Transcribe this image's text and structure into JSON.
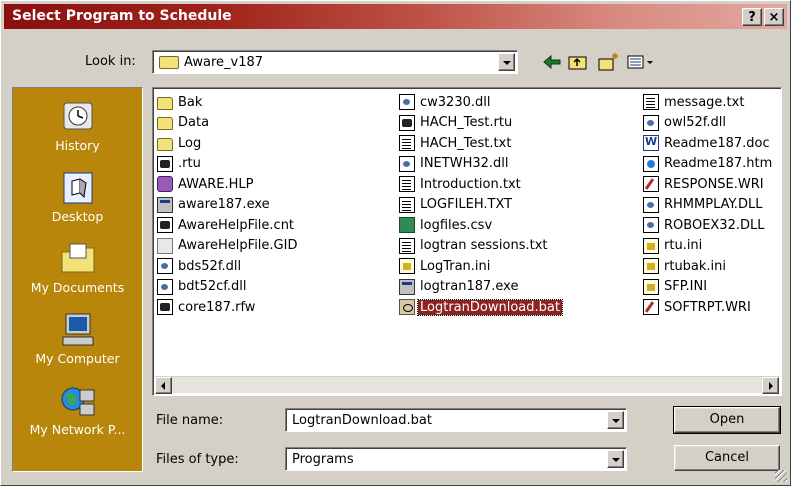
{
  "window": {
    "title": "Select Program to Schedule",
    "help_button": "?",
    "close_button": "×"
  },
  "look_in": {
    "label": "Look in:",
    "value": "Aware_v187"
  },
  "places": [
    {
      "label": "History",
      "icon": "history-icon"
    },
    {
      "label": "Desktop",
      "icon": "desktop-icon"
    },
    {
      "label": "My Documents",
      "icon": "my-documents-icon"
    },
    {
      "label": "My Computer",
      "icon": "my-computer-icon"
    },
    {
      "label": "My Network P...",
      "icon": "network-places-icon"
    }
  ],
  "files": {
    "column1": [
      {
        "name": "Bak",
        "icon": "folder"
      },
      {
        "name": "Data",
        "icon": "folder"
      },
      {
        "name": "Log",
        "icon": "folder"
      },
      {
        "name": ".rtu",
        "icon": "app"
      },
      {
        "name": "AWARE.HLP",
        "icon": "hlp"
      },
      {
        "name": "aware187.exe",
        "icon": "exe"
      },
      {
        "name": "AwareHelpFile.cnt",
        "icon": "app"
      },
      {
        "name": "AwareHelpFile.GID",
        "icon": "gid"
      },
      {
        "name": "bds52f.dll",
        "icon": "dll"
      },
      {
        "name": "bdt52cf.dll",
        "icon": "dll"
      },
      {
        "name": "core187.rfw",
        "icon": "app"
      }
    ],
    "column2": [
      {
        "name": "cw3230.dll",
        "icon": "dll"
      },
      {
        "name": "HACH_Test.rtu",
        "icon": "app"
      },
      {
        "name": "HACH_Test.txt",
        "icon": "doc"
      },
      {
        "name": "INETWH32.dll",
        "icon": "dll"
      },
      {
        "name": "Introduction.txt",
        "icon": "doc"
      },
      {
        "name": "LOGFILEH.TXT",
        "icon": "doc"
      },
      {
        "name": "logfiles.csv",
        "icon": "csv"
      },
      {
        "name": "logtran sessions.txt",
        "icon": "doc"
      },
      {
        "name": "LogTran.ini",
        "icon": "ini"
      },
      {
        "name": "logtran187.exe",
        "icon": "exe"
      },
      {
        "name": "LogtranDownload.bat",
        "icon": "bat",
        "selected": true
      }
    ],
    "column3": [
      {
        "name": "message.txt",
        "icon": "doc"
      },
      {
        "name": "owl52f.dll",
        "icon": "dll"
      },
      {
        "name": "Readme187.doc",
        "icon": "word"
      },
      {
        "name": "Readme187.htm",
        "icon": "htm"
      },
      {
        "name": "RESPONSE.WRI",
        "icon": "wri"
      },
      {
        "name": "RHMMPLAY.DLL",
        "icon": "dll"
      },
      {
        "name": "ROBOEX32.DLL",
        "icon": "dll"
      },
      {
        "name": "rtu.ini",
        "icon": "ini"
      },
      {
        "name": "rtubak.ini",
        "icon": "ini"
      },
      {
        "name": "SFP.INI",
        "icon": "ini"
      },
      {
        "name": "SOFTRPT.WRI",
        "icon": "wri"
      }
    ]
  },
  "file_name": {
    "label": "File name:",
    "value": "LogtranDownload.bat"
  },
  "files_of_type": {
    "label": "Files of type:",
    "value": "Programs"
  },
  "buttons": {
    "open": "Open",
    "cancel": "Cancel"
  },
  "colors": {
    "titlebar_start": "#8b0f0f",
    "titlebar_end": "#e3a79f",
    "places_bar": "#b8860b",
    "selection": "#8b2323",
    "face": "#d4d0c8"
  }
}
